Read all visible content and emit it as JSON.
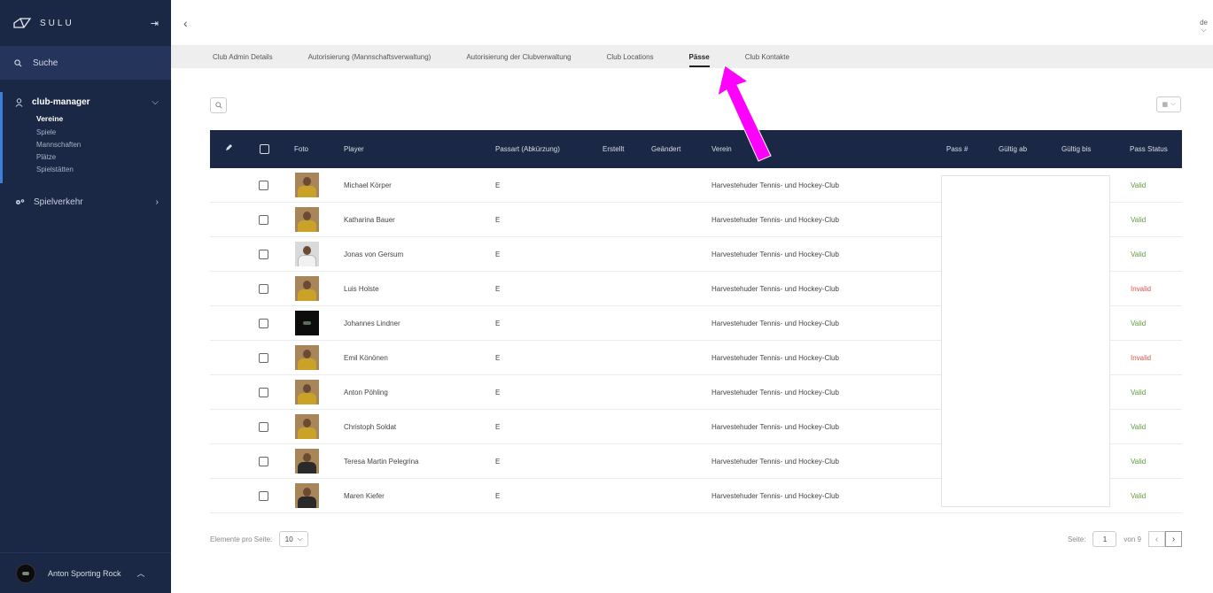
{
  "app": {
    "logo_text": "SULU"
  },
  "sidebar": {
    "search_label": "Suche",
    "group": {
      "label": "club-manager",
      "items": [
        "Vereine",
        "Spiele",
        "Mannschaften",
        "Plätze",
        "Spielstätten"
      ]
    },
    "item2_label": "Spielverkehr",
    "user_name": "Anton Sporting Rock"
  },
  "topbar": {
    "lang": "de"
  },
  "tabs": [
    "Club Admin Details",
    "Autorisierung (Mannschaftsverwaltung)",
    "Autorisierung der Clubverwaltung",
    "Club Locations",
    "Pässe",
    "Club Kontakte"
  ],
  "active_tab": "Pässe",
  "table": {
    "headers": {
      "foto": "Foto",
      "player": "Player",
      "passart": "Passart (Abkürzung)",
      "erstellt": "Erstellt",
      "geaendert": "Geändert",
      "verein": "Verein",
      "pass": "Pass #",
      "gueltig_ab": "Gültig ab",
      "gueltig_bis": "Gültig bis",
      "status": "Pass Status"
    },
    "rows": [
      {
        "player": "Michael Körper",
        "passart": "E",
        "verein": "Harvestehuder Tennis- und Hockey-Club",
        "status": "Valid"
      },
      {
        "player": "Katharina Bauer",
        "passart": "E",
        "verein": "Harvestehuder Tennis- und Hockey-Club",
        "status": "Valid"
      },
      {
        "player": "Jonas von Gersum",
        "passart": "E",
        "verein": "Harvestehuder Tennis- und Hockey-Club",
        "status": "Valid"
      },
      {
        "player": "Luis Holste",
        "passart": "E",
        "verein": "Harvestehuder Tennis- und Hockey-Club",
        "status": "Invalid"
      },
      {
        "player": "Johannes Lindner",
        "passart": "E",
        "verein": "Harvestehuder Tennis- und Hockey-Club",
        "status": "Valid"
      },
      {
        "player": "Emil Könönen",
        "passart": "E",
        "verein": "Harvestehuder Tennis- und Hockey-Club",
        "status": "Invalid"
      },
      {
        "player": "Anton Pöhling",
        "passart": "E",
        "verein": "Harvestehuder Tennis- und Hockey-Club",
        "status": "Valid"
      },
      {
        "player": "Christoph Soldat",
        "passart": "E",
        "verein": "Harvestehuder Tennis- und Hockey-Club",
        "status": "Valid"
      },
      {
        "player": "Teresa Martin Pelegrina",
        "passart": "E",
        "verein": "Harvestehuder Tennis- und Hockey-Club",
        "status": "Valid"
      },
      {
        "player": "Maren Kiefer",
        "passart": "E",
        "verein": "Harvestehuder Tennis- und Hockey-Club",
        "status": "Valid"
      }
    ]
  },
  "pagination": {
    "per_page_label": "Elemente pro Seite:",
    "per_page_value": "10",
    "page_label": "Seite:",
    "page_value": "1",
    "of_label": "von 9"
  },
  "colors": {
    "sidebar_bg": "#1b2845",
    "valid": "#5e9a3c",
    "invalid": "#d9534f",
    "annotation_arrow": "#ff00ff"
  }
}
